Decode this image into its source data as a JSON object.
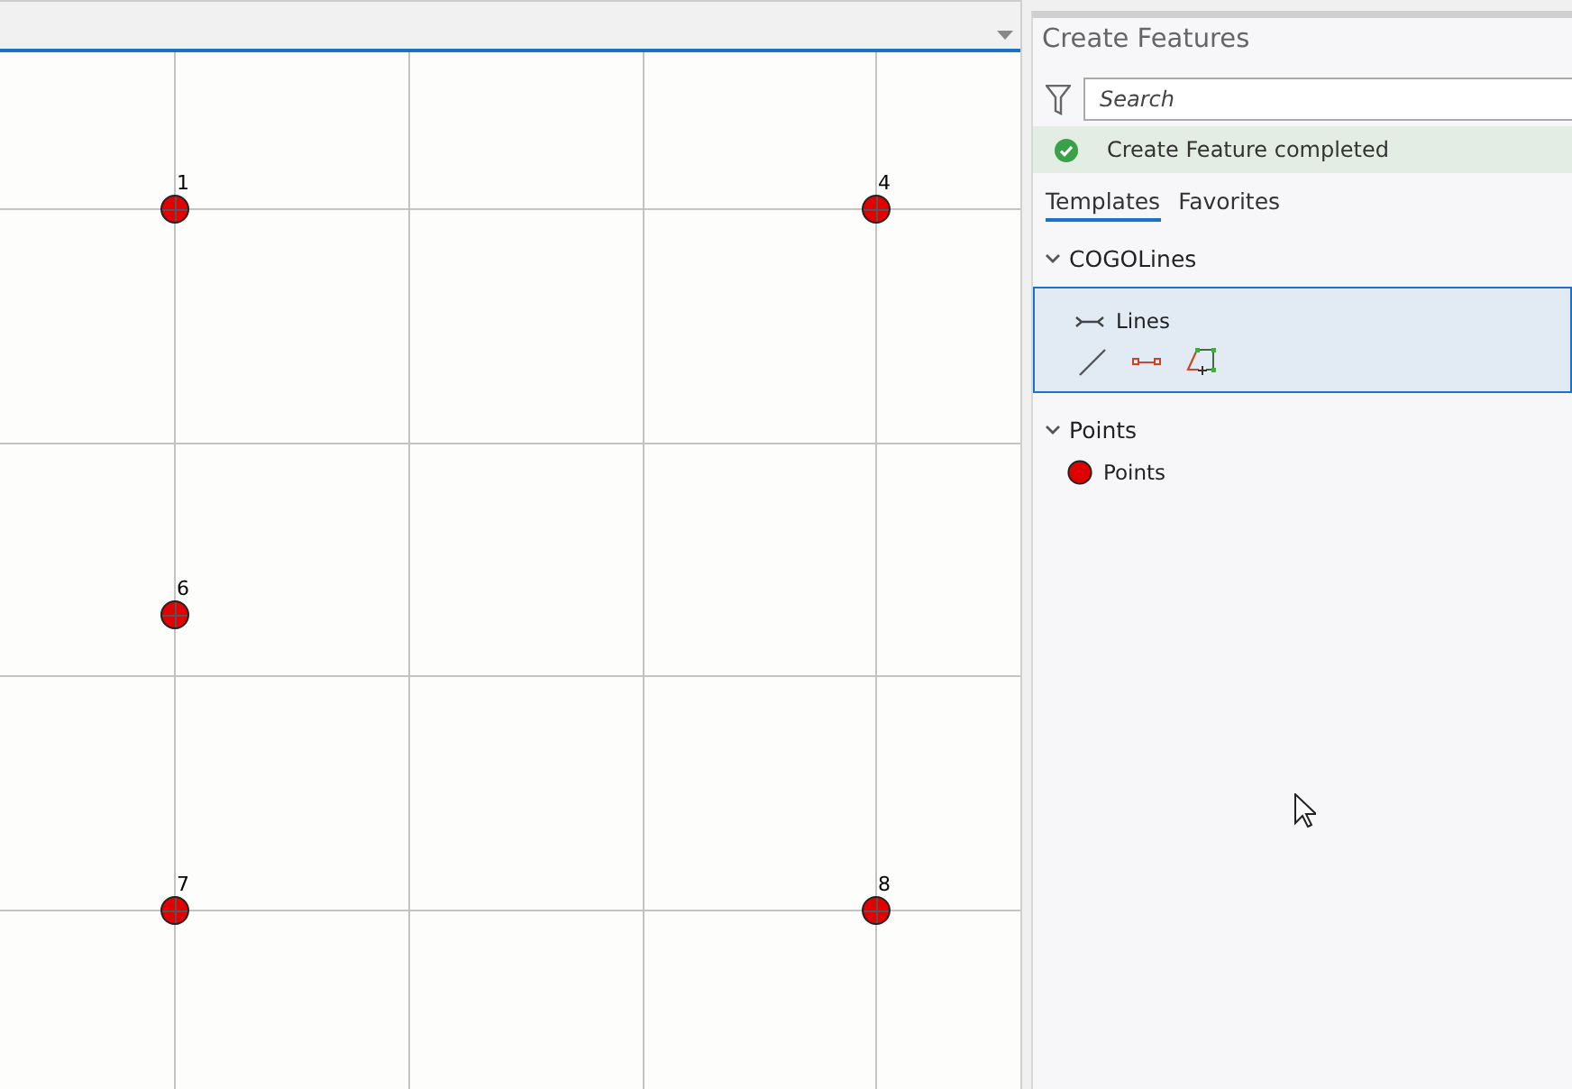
{
  "map": {
    "points": [
      {
        "label": "1"
      },
      {
        "label": "4"
      },
      {
        "label": "6"
      },
      {
        "label": "7"
      },
      {
        "label": "8"
      }
    ]
  },
  "panel": {
    "title": "Create Features",
    "search": {
      "placeholder": "Search"
    },
    "status": {
      "text": "Create Feature completed"
    },
    "tabs": [
      {
        "label": "Templates",
        "selected": true
      },
      {
        "label": "Favorites",
        "selected": false
      }
    ],
    "groups": [
      {
        "name": "COGOLines",
        "expanded": true,
        "templates": [
          {
            "name": "Lines",
            "kind": "line",
            "selected": true
          }
        ]
      },
      {
        "name": "Points",
        "expanded": true,
        "templates": [
          {
            "name": "Points",
            "kind": "point",
            "selected": false
          }
        ]
      }
    ]
  }
}
